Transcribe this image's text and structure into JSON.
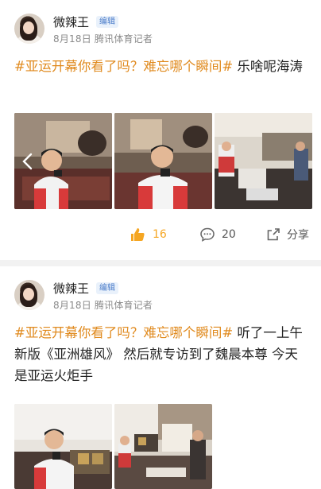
{
  "posts": [
    {
      "author": "微辣王",
      "badge": "编辑",
      "date": "8月18日",
      "source": "腾讯体育记者",
      "tag": "#亚运开幕你看了吗？难忘哪个瞬间#",
      "body": " 乐啥呢海涛",
      "likes": "16",
      "comments": "20",
      "share_label": "分享"
    },
    {
      "author": "微辣王",
      "badge": "编辑",
      "date": "8月18日",
      "source": "腾讯体育记者",
      "tag": "#亚运开幕你看了吗？难忘哪个瞬间#",
      "body": " 听了一上午新版《亚洲雄风》 然后就专访到了魏晨本尊 今天是亚运火炬手"
    }
  ],
  "colors": {
    "tag": "#e08a1e",
    "like": "#f5a623",
    "badge_bg": "#e9f1fb",
    "badge_text": "#4a7cc9"
  },
  "icons": [
    "thumbs-up-icon",
    "comment-icon",
    "share-icon",
    "chevron-left-icon"
  ]
}
